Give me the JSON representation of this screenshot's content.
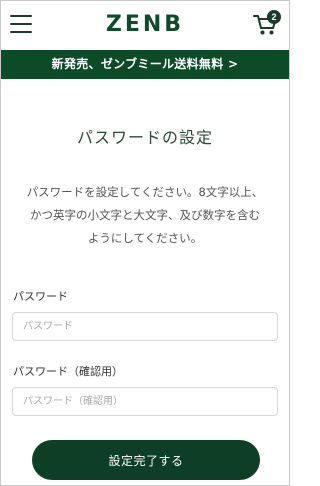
{
  "header": {
    "logo_text": "ZENB",
    "cart_count": "2",
    "menu_icon": "hamburger-menu-icon",
    "cart_icon": "shopping-cart-icon"
  },
  "banner": {
    "text": "新発売、ゼンブミール送料無料 >"
  },
  "form": {
    "title": "パスワードの設定",
    "description_line1": "パスワードを設定してください。8文字以上、",
    "description_line2": "かつ英字の小文字と大文字、及び数字を含む",
    "description_line3": "ようにしてください。",
    "password_label": "パスワード",
    "password_placeholder": "パスワード",
    "password_value": "",
    "confirm_label": "パスワード（確認用）",
    "confirm_placeholder": "パスワード（確認用）",
    "confirm_value": "",
    "submit_label": "設定完了する"
  },
  "colors": {
    "brand_green": "#0e4a2b",
    "banner_bg": "#0c4a28",
    "button_bg": "#0e3f26"
  }
}
